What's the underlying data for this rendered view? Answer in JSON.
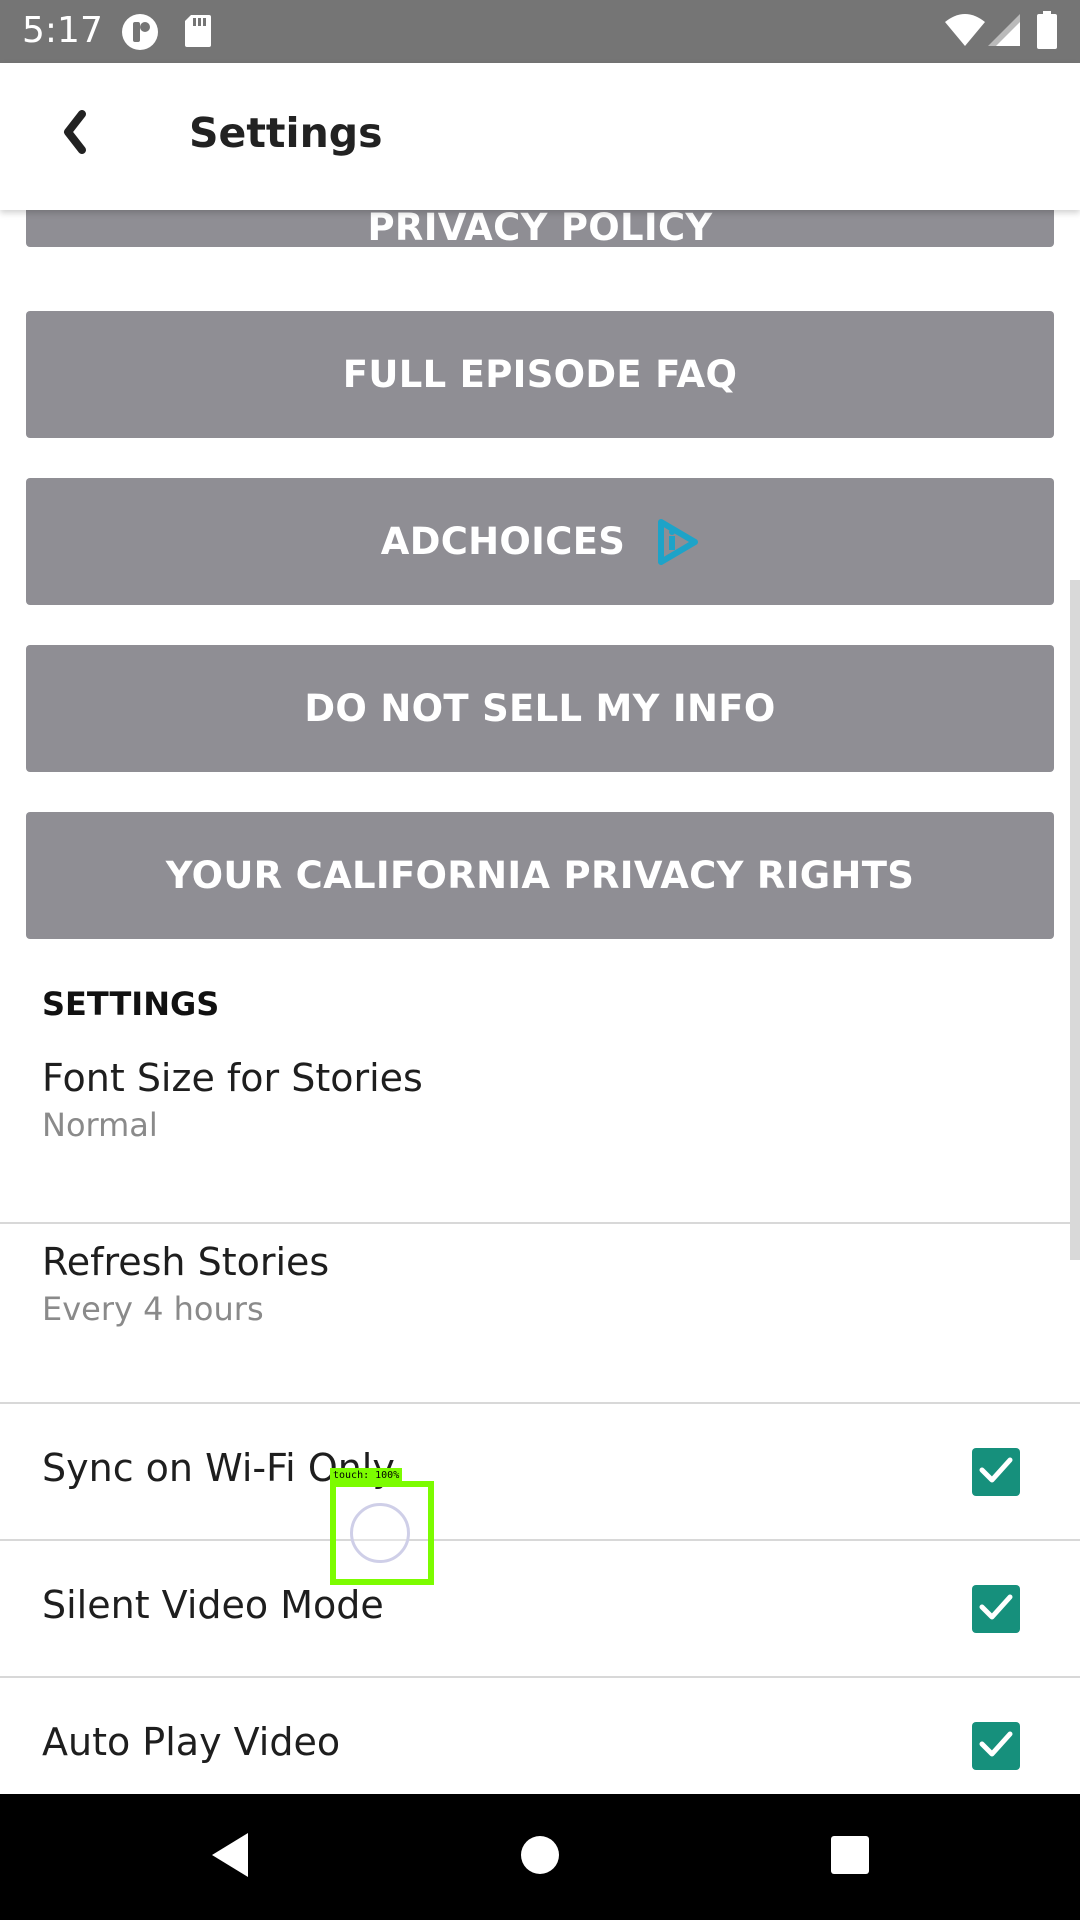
{
  "status_bar": {
    "time": "5:17",
    "icons": [
      "notification-icon",
      "sd-card-icon",
      "wifi-icon",
      "cellular-icon",
      "battery-icon"
    ]
  },
  "app_bar": {
    "title": "Settings",
    "back_icon": "back-chevron-icon"
  },
  "buttons": [
    {
      "label": "PRIVACY POLICY"
    },
    {
      "label": "FULL EPISODE FAQ"
    },
    {
      "label": "ADCHOICES",
      "icon": "adchoices-icon"
    },
    {
      "label": "DO NOT SELL MY INFO"
    },
    {
      "label": "YOUR CALIFORNIA PRIVACY RIGHTS"
    }
  ],
  "settings": {
    "header": "SETTINGS",
    "items": [
      {
        "title": "Font Size for Stories",
        "subtitle": "Normal"
      },
      {
        "title": "Refresh Stories",
        "subtitle": "Every 4 hours"
      },
      {
        "title": "Sync on Wi-Fi Only",
        "checked": true
      },
      {
        "title": "Silent Video Mode",
        "checked": true
      },
      {
        "title": "Auto Play Video",
        "checked": true
      }
    ]
  },
  "touch_indicator": {
    "label": "touch: 100%"
  },
  "nav_bar": {
    "buttons": [
      "back-triangle-icon",
      "home-circle-icon",
      "recents-square-icon"
    ]
  },
  "colors": {
    "status_bar": "#757575",
    "button_gray": "#8f8e94",
    "checkbox_teal": "#16907c",
    "adchoices_blue": "#1ea3c8",
    "touch_green": "#7cfc00"
  }
}
